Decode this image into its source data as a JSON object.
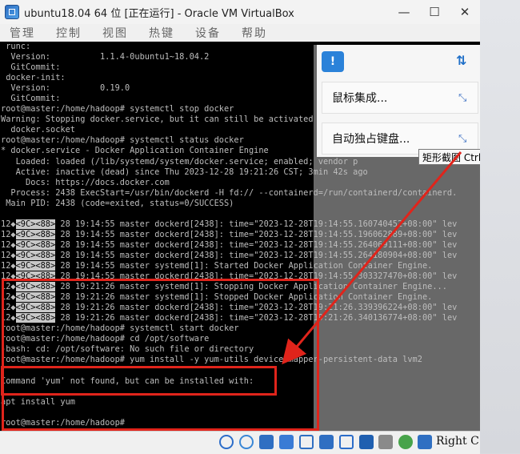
{
  "window": {
    "title": "ubuntu18.04 64 位 [正在运行] - Oracle VM VirtualBox",
    "minimize": "—",
    "maximize": "☐",
    "close": "✕"
  },
  "menu": {
    "items": [
      "管理",
      "控制",
      "视图",
      "热键",
      "设备",
      "帮助"
    ]
  },
  "terminal": {
    "lines": [
      " runc:",
      "  Version:          1.1.4-0ubuntu1~18.04.2",
      "  GitCommit:",
      " docker-init:",
      "  Version:          0.19.0",
      "  GitCommit:",
      "root@master:/home/hadoop# systemctl stop docker",
      "Warning: Stopping docker.service, but it can still be activated by:",
      "  docker.socket",
      "root@master:/home/hadoop# systemctl status docker",
      "* docker.service - Docker Application Container Engine",
      "   Loaded: loaded (/lib/systemd/system/docker.service; enabled; vendor p",
      "   Active: inactive (dead) since Thu 2023-12-28 19:21:26 CST; 3min 42s ago",
      "     Docs: https://docs.docker.com",
      "  Process: 2438 ExecStart=/usr/bin/dockerd -H fd:// --containerd=/run/containerd/containerd.",
      " Main PID: 2438 (code=exited, status=0/SUCCESS)",
      "",
      "12◆<9C><88> 28 19:14:55 master dockerd[2438]: time=\"2023-12-28T19:14:55.160740452+08:00\" lev",
      "12◆<9C><88> 28 19:14:55 master dockerd[2438]: time=\"2023-12-28T19:14:55.196062889+08:00\" lev",
      "12◆<9C><88> 28 19:14:55 master dockerd[2438]: time=\"2023-12-28T19:14:55.264069111+08:00\" lev",
      "12◆<9C><88> 28 19:14:55 master dockerd[2438]: time=\"2023-12-28T19:14:55.264180904+08:00\" lev",
      "12◆<9C><88> 28 19:14:55 master systemd[1]: Started Docker Application Container Engine.",
      "12◆<9C><88> 28 19:14:55 master dockerd[2438]: time=\"2023-12-28T19:14:55.303327470+08:00\" lev",
      "12◆<9C><88> 28 19:21:26 master systemd[1]: Stopping Docker Application Container Engine...",
      "12◆<9C><88> 28 19:21:26 master systemd[1]: Stopped Docker Application Container Engine.",
      "12◆<9C><88> 28 19:21:26 master dockerd[2438]: time=\"2023-12-28T19:21:26.339396224+08:00\" lev",
      "12◆<9C><88> 28 19:21:26 master dockerd[2438]: time=\"2023-12-28T19:21:26.340136774+08:00\" lev",
      "root@master:/home/hadoop# systemctl start docker",
      "root@master:/home/hadoop# cd /opt/software",
      "-bash: cd: /opt/software: No such file or directory",
      "root@master:/home/hadoop# yum install -y yum-utils device-mapper-persistent-data lvm2",
      "",
      "Command 'yum' not found, but can be installed with:",
      "",
      "apt install yum",
      "",
      "root@master:/home/hadoop#"
    ]
  },
  "side_panel": {
    "mouse_integration": "鼠标集成...",
    "auto_capture_keyboard": "自动独占键盘...",
    "tooltip": "矩形截图 Ctrl + Alt + A",
    "hint_icon_text": "!"
  },
  "statusbar": {
    "host_key": "Right C"
  },
  "colors": {
    "annotation": "#e0241b",
    "terminal_bg": "#000000",
    "terminal_fg": "#bdbdbd"
  }
}
